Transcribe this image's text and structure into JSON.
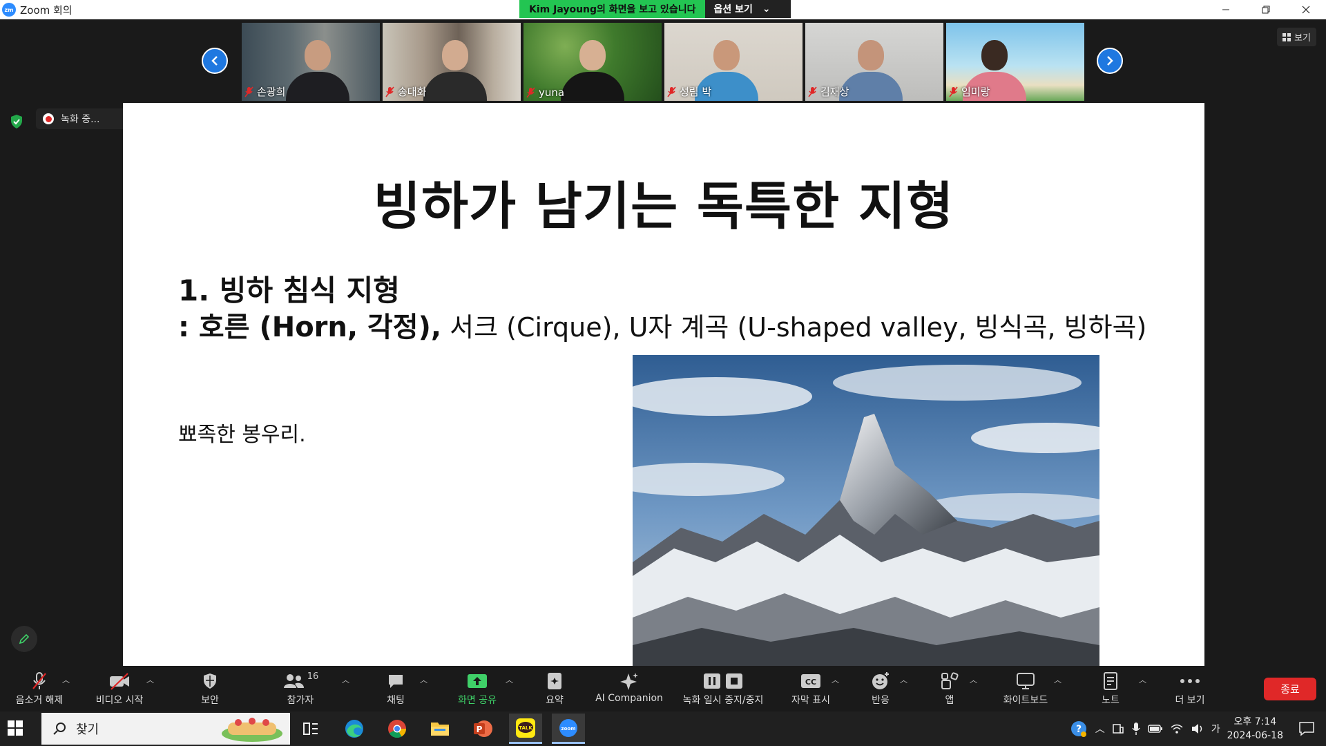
{
  "window": {
    "app_icon_text": "zm",
    "title": "Zoom 회의",
    "share_banner": "Kim Jayoung의 화면을 보고 있습니다",
    "options_label": "옵션 보기"
  },
  "view_button": "보기",
  "participants": [
    {
      "name": "손광희"
    },
    {
      "name": "송대화"
    },
    {
      "name": "yuna"
    },
    {
      "name": "성림 박"
    },
    {
      "name": "김재상"
    },
    {
      "name": "임미랑"
    }
  ],
  "recording": {
    "label": "녹화 중..."
  },
  "slide": {
    "title": "빙하가 남기는 독특한 지형",
    "heading": "1.   빙하 침식 지형",
    "subheading_bold": ": 호른 (Horn, 각정),",
    "subheading_rest": " 서크 (Cirque), U자 계곡 (U-shaped valley, 빙식곡, 빙하곡)",
    "body": "뾰족한 봉우리."
  },
  "toolbar": {
    "unmute": "음소거 해제",
    "start_video": "비디오 시작",
    "security": "보안",
    "participants": "참가자",
    "participant_count": "16",
    "chat": "채팅",
    "share_screen": "화면 공유",
    "summary": "요약",
    "ai_companion": "AI Companion",
    "recording_control": "녹화 일시 중지/중지",
    "captions": "자막 표시",
    "reactions": "반응",
    "apps": "앱",
    "whiteboard": "화이트보드",
    "notes": "노트",
    "more": "더 보기",
    "end": "종료"
  },
  "taskbar": {
    "search_label": "찾기",
    "kakaotalk_label": "TALK",
    "zoom_label": "zoom",
    "powerpoint_label": "P",
    "ime": "가",
    "time": "오후 7:14",
    "date": "2024-06-18"
  },
  "colors": {
    "share_green": "#23c552",
    "zoom_blue": "#2d8cff",
    "end_red": "#e02828",
    "active_green": "#3fd068"
  }
}
